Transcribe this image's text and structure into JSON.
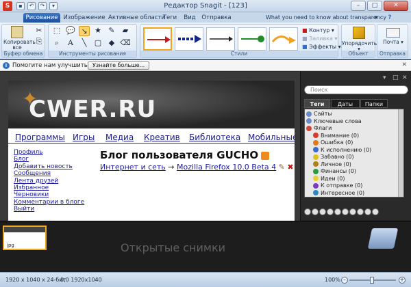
{
  "window": {
    "title": "Редактор Snagit - [123]",
    "app_icon": "S"
  },
  "quick_access": [
    "save-icon",
    "undo-icon",
    "redo-icon",
    "dropdown-icon"
  ],
  "tabs": {
    "menu": "Рисование",
    "items": [
      "Изображение",
      "Активные области",
      "Теги",
      "Вид",
      "Отправка"
    ],
    "help_link": "What you need to know about transparency"
  },
  "ribbon": {
    "clipboard": {
      "paste_label": "Копировать все",
      "group_label": "Буфер обмена"
    },
    "tools": {
      "group_label": "Инструменты рисования"
    },
    "styles": {
      "group_label": "Стили",
      "colors": [
        "#c11a1a",
        "#14278a",
        "#222222",
        "#1f8c2a",
        "#f0a020"
      ],
      "contour": "Контур",
      "fill": "Заливка",
      "effects": "Эффекты"
    },
    "object": {
      "arrange_label": "Упорядочить",
      "group_label": "Объект"
    },
    "send": {
      "mail_label": "Почта",
      "group_label": "Отправка"
    }
  },
  "infobar": {
    "text": "Помогите нам улучшить Snagit",
    "button": "Узнайте больше..."
  },
  "webpage": {
    "logo": "CWER.RU",
    "nav": [
      "Программы",
      "Игры",
      "Медиа",
      "Креатив",
      "Библиотека",
      "Мобильные"
    ],
    "left_links": [
      "Профиль",
      "Блог",
      "Добавить новость",
      "Сообщения",
      "Лента друзей",
      "Избранное",
      "Черновики",
      "Комментарии в блоге",
      "Выйти"
    ],
    "blog_title": "Блог пользователя GUCHO",
    "breadcrumb_a": "Интернет и сеть",
    "breadcrumb_arrow": "→",
    "breadcrumb_b": "Mozilla Firefox 10.0 Beta 4"
  },
  "library": {
    "search_placeholder": "Поиск",
    "tabs": [
      "Теги",
      "Даты",
      "Папки"
    ],
    "tags": [
      {
        "label": "Сайты",
        "color": "#6a8cc8",
        "child": false
      },
      {
        "label": "Ключевые слова",
        "color": "#6a8cc8",
        "child": false
      },
      {
        "label": "Флаги",
        "color": "#d04a3a",
        "child": false
      },
      {
        "label": "Внимание (0)",
        "color": "#d83a2a",
        "child": true
      },
      {
        "label": "Ошибка (0)",
        "color": "#e07a1a",
        "child": true
      },
      {
        "label": "К исполнению (0)",
        "color": "#3a6ad0",
        "child": true
      },
      {
        "label": "Забавно (0)",
        "color": "#e0c01a",
        "child": true
      },
      {
        "label": "Личное (0)",
        "color": "#b0801a",
        "child": true
      },
      {
        "label": "Финансы (0)",
        "color": "#2a9a3a",
        "child": true
      },
      {
        "label": "Идеи (0)",
        "color": "#e8d030",
        "child": true
      },
      {
        "label": "К отправке (0)",
        "color": "#7a3ac0",
        "child": true
      },
      {
        "label": "Интересное (0)",
        "color": "#2a8ac0",
        "child": true
      }
    ]
  },
  "tray": {
    "thumb_label": "jpg",
    "empty_text": "Открытые снимки"
  },
  "status": {
    "dimensions": "1920 x 1040 x 24-бит",
    "coords": "0,0  1920x1040",
    "zoom": "100%"
  }
}
